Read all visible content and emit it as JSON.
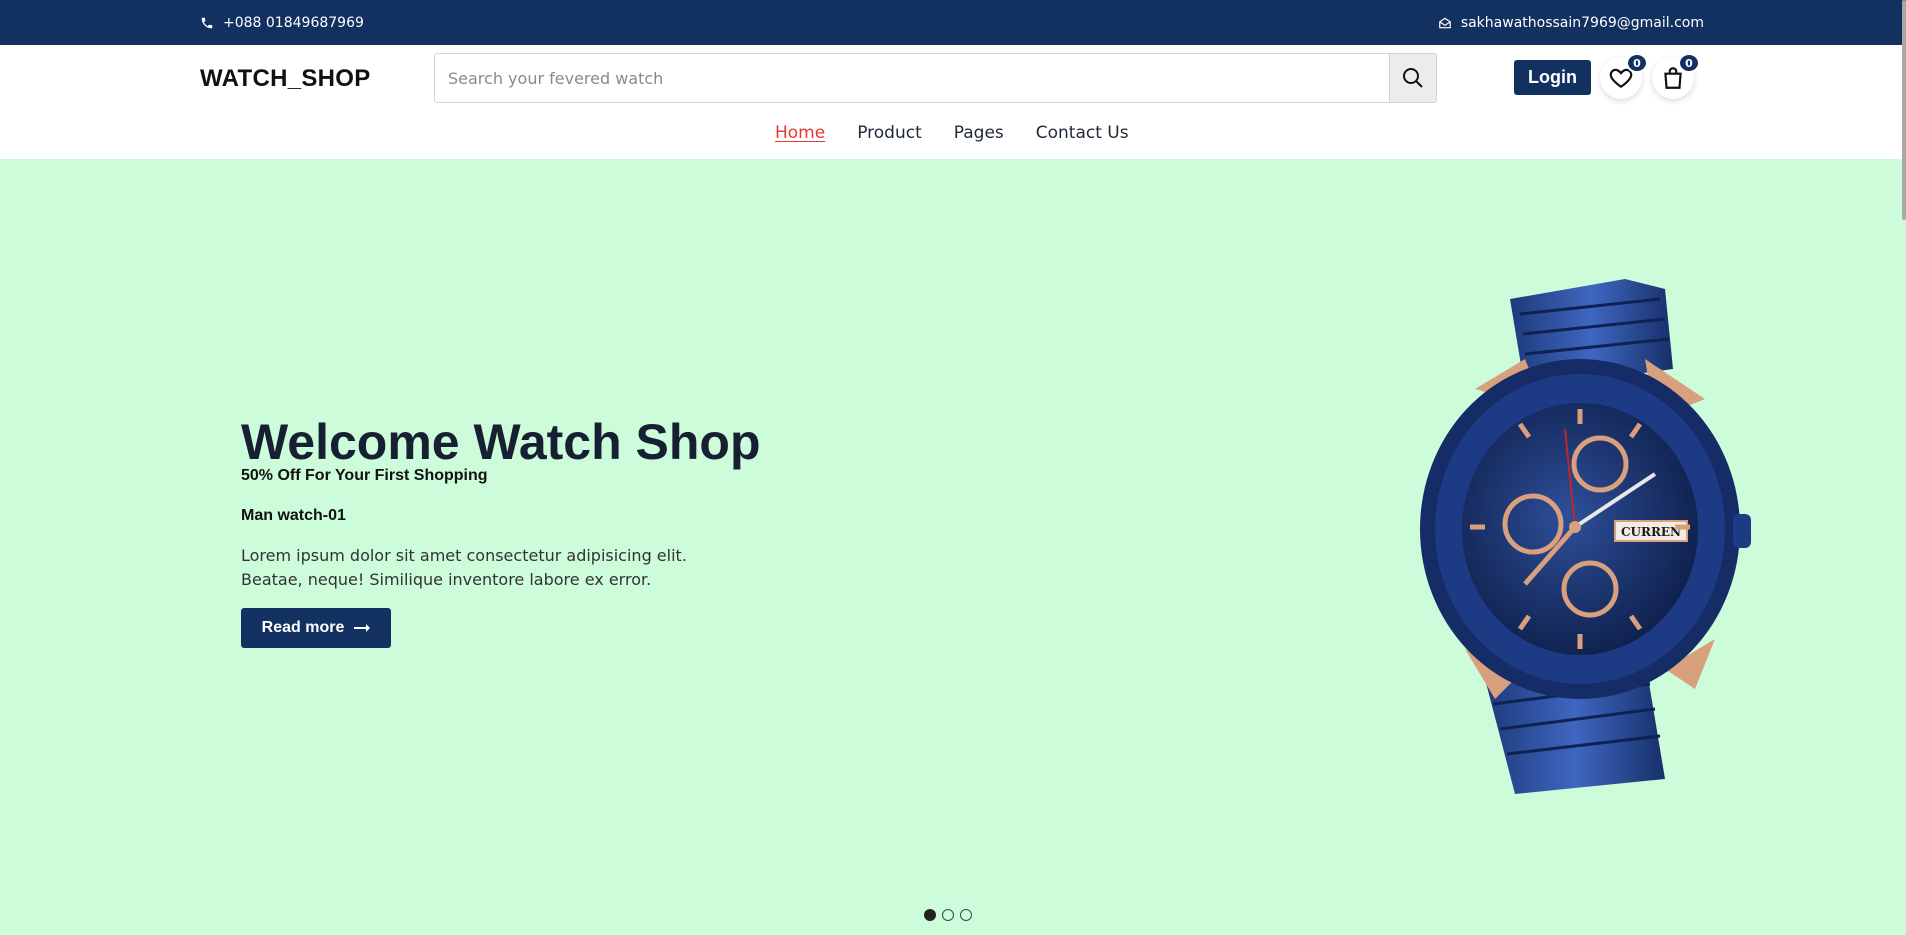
{
  "topbar": {
    "phone": "+088 01849687969",
    "email": "sakhawathossain7969@gmail.com"
  },
  "header": {
    "logo": "WATCH_SHOP",
    "search_placeholder": "Search your fevered watch",
    "login_label": "Login",
    "wishlist_count": "0",
    "cart_count": "0"
  },
  "nav": {
    "items": [
      {
        "label": "Home",
        "active": true
      },
      {
        "label": "Product"
      },
      {
        "label": "Pages"
      },
      {
        "label": "Contact Us"
      }
    ]
  },
  "hero": {
    "title": "Welcome Watch Shop",
    "offer": "50% Off For Your First Shopping",
    "model": "Man watch-01",
    "description": "Lorem ipsum dolor sit amet consectetur adipisicing elit. Beatae, neque! Similique inventore labore ex error.",
    "button_label": "Read more",
    "watch_brand": "CURREN",
    "slides_total": 3,
    "slide_active": 1
  },
  "colors": {
    "primary": "#123060",
    "hero_bg": "#ccfcd9",
    "active_link": "#e53935"
  },
  "icons": [
    "phone-icon",
    "envelope-icon",
    "search-icon",
    "heart-icon",
    "bag-icon",
    "arrow-right-icon"
  ]
}
